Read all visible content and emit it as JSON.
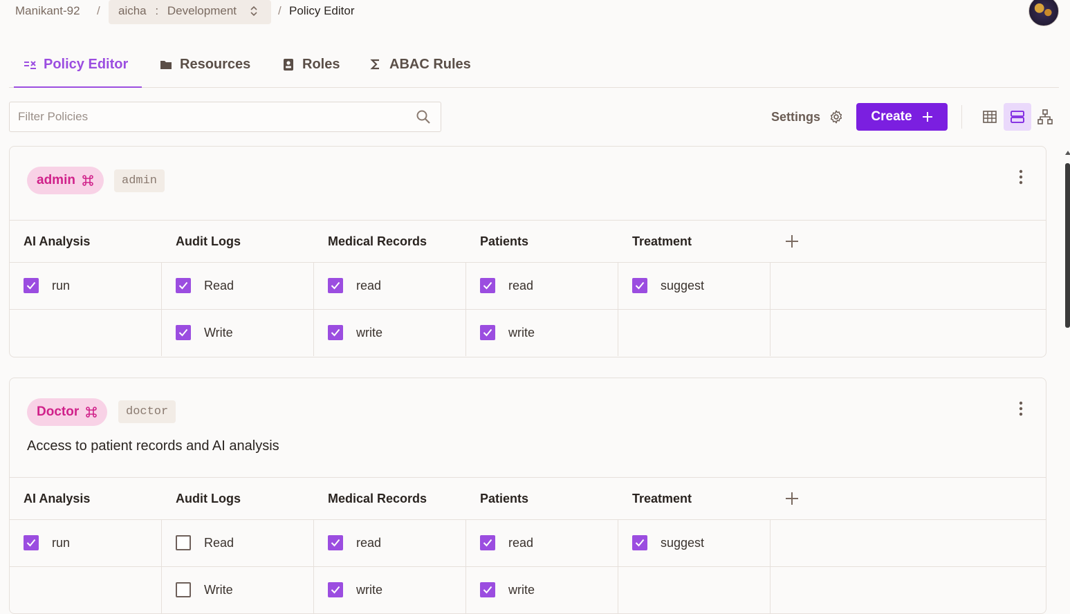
{
  "breadcrumb": {
    "org": "Manikant-92",
    "separator": "/",
    "project": "aicha",
    "env_sep": ":",
    "environment": "Development",
    "page": "Policy Editor"
  },
  "tabs": [
    {
      "label": "Policy Editor",
      "icon": "policy-editor-icon",
      "active": true
    },
    {
      "label": "Resources",
      "icon": "folder-icon"
    },
    {
      "label": "Roles",
      "icon": "role-badge-icon"
    },
    {
      "label": "ABAC Rules",
      "icon": "sigma-icon"
    }
  ],
  "toolbar": {
    "filter_placeholder": "Filter Policies",
    "settings_label": "Settings",
    "create_label": "Create",
    "views": [
      "table-view",
      "list-view",
      "hierarchy-view"
    ],
    "active_view": "list-view"
  },
  "colors": {
    "accent": "#9b4de0",
    "create": "#7b1fe0",
    "pill_bg": "#f8d2e6",
    "pill_text": "#d0218a"
  },
  "resources": [
    "AI Analysis",
    "Audit Logs",
    "Medical Records",
    "Patients",
    "Treatment"
  ],
  "roles": [
    {
      "name": "admin",
      "key": "admin",
      "description": "",
      "rows": [
        [
          {
            "label": "run",
            "checked": true
          },
          {
            "label": "Read",
            "checked": true
          },
          {
            "label": "read",
            "checked": true
          },
          {
            "label": "read",
            "checked": true
          },
          {
            "label": "suggest",
            "checked": true
          }
        ],
        [
          null,
          {
            "label": "Write",
            "checked": true
          },
          {
            "label": "write",
            "checked": true
          },
          {
            "label": "write",
            "checked": true
          },
          null
        ]
      ]
    },
    {
      "name": "Doctor",
      "key": "doctor",
      "description": "Access to patient records and AI analysis",
      "rows": [
        [
          {
            "label": "run",
            "checked": true
          },
          {
            "label": "Read",
            "checked": false
          },
          {
            "label": "read",
            "checked": true
          },
          {
            "label": "read",
            "checked": true
          },
          {
            "label": "suggest",
            "checked": true
          }
        ],
        [
          null,
          {
            "label": "Write",
            "checked": false
          },
          {
            "label": "write",
            "checked": true
          },
          {
            "label": "write",
            "checked": true
          },
          null
        ]
      ]
    }
  ]
}
